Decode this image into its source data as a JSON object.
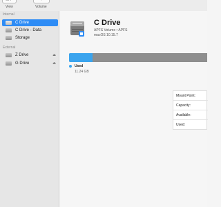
{
  "toolbar": {
    "view_label": "View",
    "volume_label": "Volume"
  },
  "sidebar": {
    "internal_title": "Internal",
    "external_title": "External",
    "items": [
      {
        "label": "C Drive",
        "selected": true
      },
      {
        "label": "C Drive - Data",
        "selected": false
      },
      {
        "label": "Storage",
        "selected": false
      },
      {
        "label": "Z Drive",
        "selected": false,
        "eject": true
      },
      {
        "label": "G Drive",
        "selected": false,
        "eject": true
      }
    ]
  },
  "main": {
    "title": "C Drive",
    "subtitle": "APFS Volume • APFS",
    "version": "macOS 10.15.7",
    "usage": {
      "used_fraction": 0.17,
      "legend_label": "Used",
      "legend_value": "11.24 GB"
    },
    "info": {
      "rows": [
        "Mount Point:",
        "Capacity:",
        "Available:",
        "Used:"
      ]
    }
  },
  "colors": {
    "accent": "#2e8cf5",
    "used": "#3aa4ee",
    "free": "#8e8e8e"
  }
}
